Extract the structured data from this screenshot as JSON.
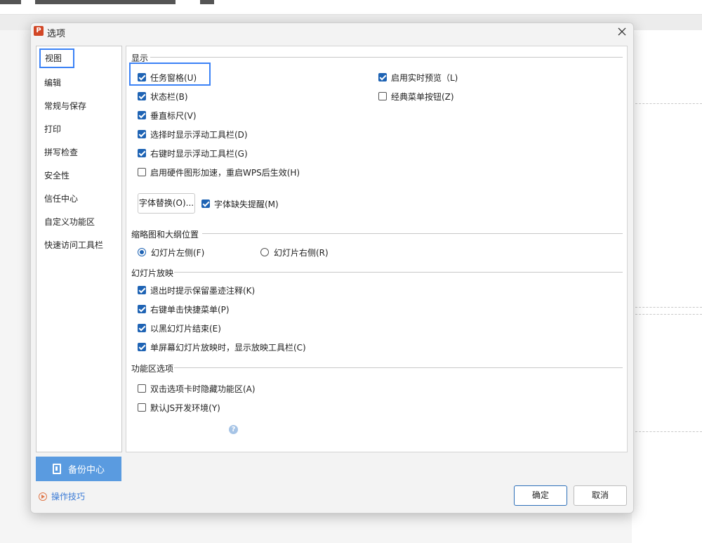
{
  "dialog": {
    "title": "选项",
    "app_icon_letter": "P"
  },
  "nav": {
    "items": [
      {
        "label": "视图",
        "active": true
      },
      {
        "label": "编辑"
      },
      {
        "label": "常规与保存"
      },
      {
        "label": "打印"
      },
      {
        "label": "拼写检查"
      },
      {
        "label": "安全性"
      },
      {
        "label": "信任中心"
      },
      {
        "label": "自定义功能区"
      },
      {
        "label": "快速访问工具栏"
      }
    ]
  },
  "sections": {
    "display": {
      "title": "显示",
      "options": [
        {
          "label": "任务窗格(U)",
          "checked": true
        },
        {
          "label": "状态栏(B)",
          "checked": true
        },
        {
          "label": "垂直标尺(V)",
          "checked": true
        },
        {
          "label": "选择时显示浮动工具栏(D)",
          "checked": true
        },
        {
          "label": "右键时显示浮动工具栏(G)",
          "checked": true
        },
        {
          "label": "启用硬件图形加速，重启WPS后生效(H)",
          "checked": false
        },
        {
          "label": "启用实时预览（L)",
          "checked": true
        },
        {
          "label": "经典菜单按钮(Z)",
          "checked": false
        }
      ],
      "font_replace_button": "字体替换(O)...",
      "font_missing": {
        "label": "字体缺失提醒(M)",
        "checked": true
      }
    },
    "thumbnail": {
      "title": "缩略图和大纲位置",
      "options": [
        {
          "label": "幻灯片左侧(F)",
          "selected": true
        },
        {
          "label": "幻灯片右侧(R)",
          "selected": false
        }
      ]
    },
    "slideshow": {
      "title": "幻灯片放映",
      "options": [
        {
          "label": "退出时提示保留墨迹注释(K)",
          "checked": true
        },
        {
          "label": "右键单击快捷菜单(P)",
          "checked": true
        },
        {
          "label": "以黑幻灯片结束(E)",
          "checked": true
        },
        {
          "label": "单屏幕幻灯片放映时，显示放映工具栏(C)",
          "checked": true
        }
      ]
    },
    "ribbon": {
      "title": "功能区选项",
      "options": [
        {
          "label": "双击选项卡时隐藏功能区(A)",
          "checked": false
        },
        {
          "label": "默认JS开发环境(Y)",
          "checked": false
        }
      ],
      "help_icon": "help-icon"
    }
  },
  "footer": {
    "backup_label": "备份中心",
    "tips_label": "操作技巧",
    "ok_label": "确定",
    "cancel_label": "取消"
  },
  "colors": {
    "accent": "#1e63b4",
    "highlight": "#3b82f6",
    "backup_bg": "#5a9be0",
    "app_icon": "#d24726"
  }
}
